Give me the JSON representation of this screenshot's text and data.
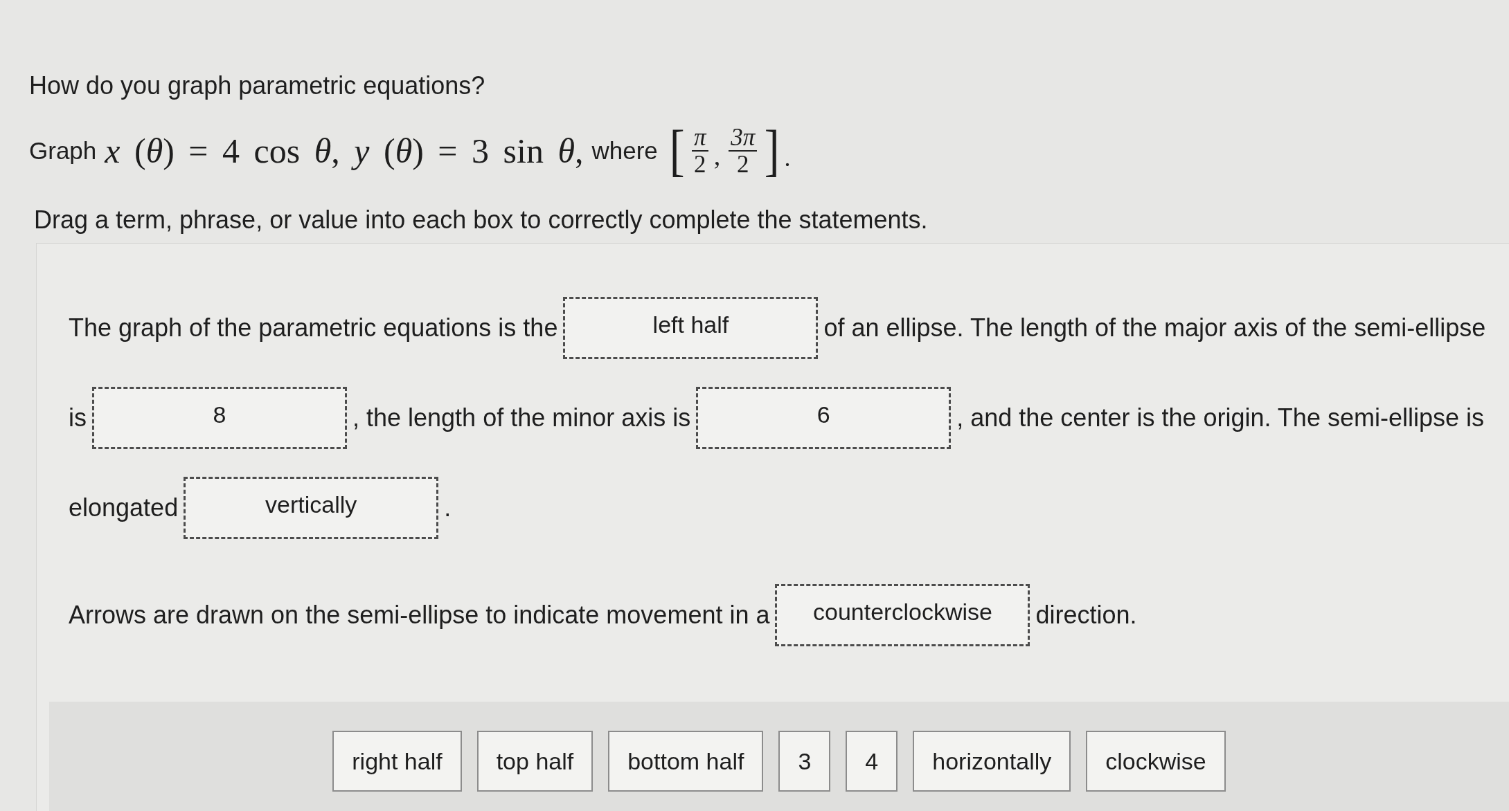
{
  "question": "How do you graph parametric equations?",
  "prompt": {
    "lead": "Graph",
    "equation": "*x* (*θ*) = 4 cos *θ*, *y* (*θ*) = 3 sin *θ*,",
    "connector": "where",
    "interval": {
      "open": "[",
      "bounds": [
        {
          "numerator": "π",
          "denominator": "2"
        },
        {
          "numerator": "3π",
          "denominator": "2"
        }
      ],
      "separator": ",",
      "close": "]"
    },
    "end": "."
  },
  "instruction": "Drag a term, phrase, or value into each box to correctly complete the statements.",
  "statements": [
    {
      "segments": [
        {
          "kind": "text",
          "text": "The graph of the parametric equations is the"
        },
        {
          "kind": "drop",
          "value": "left half"
        },
        {
          "kind": "text",
          "text": "of an ellipse. The length of the major axis of the semi-ellipse"
        },
        {
          "kind": "text",
          "text": "is"
        },
        {
          "kind": "drop",
          "value": "8"
        },
        {
          "kind": "text",
          "text": ", the length of the minor axis is"
        },
        {
          "kind": "drop",
          "value": "6"
        },
        {
          "kind": "text",
          "text": ", and the center is the origin. The semi-ellipse is"
        },
        {
          "kind": "text",
          "text": "elongated"
        },
        {
          "kind": "drop",
          "value": "vertically"
        },
        {
          "kind": "text",
          "text": "."
        }
      ]
    },
    {
      "segments": [
        {
          "kind": "text",
          "text": "Arrows are drawn on the semi-ellipse to indicate movement in a"
        },
        {
          "kind": "drop",
          "value": "counterclockwise"
        },
        {
          "kind": "text",
          "text": "direction."
        }
      ]
    }
  ],
  "answer_bank": [
    "right half",
    "top half",
    "bottom half",
    "3",
    "4",
    "horizontally",
    "clockwise"
  ]
}
